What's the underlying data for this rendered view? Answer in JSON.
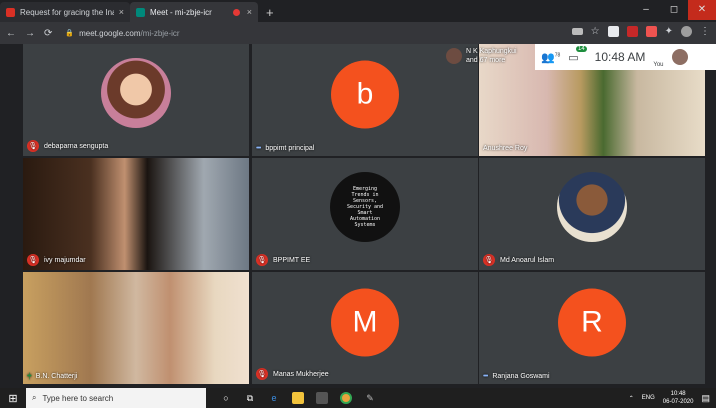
{
  "browser": {
    "tabs": [
      {
        "title": "Request for gracing the Inaugur",
        "close": "×",
        "favicon_color": "#d93025"
      },
      {
        "title": "Meet - mi-zbje-icr",
        "close": "×",
        "favicon_color": "#00897b"
      }
    ],
    "new_tab": "+",
    "window_controls": [
      "–",
      "◻",
      "✕"
    ],
    "url_host": "meet.google.com",
    "url_path": "/mi-zbje-icr"
  },
  "meet": {
    "owner_name": "N K Kaphungkui",
    "participant_more": "and 67 more",
    "people_count": "78",
    "chat_badge": "14",
    "time": "10:48 AM",
    "you_label": "You",
    "tiles": [
      {
        "name": "debaparna sengupta",
        "muted": true,
        "kind": "photo"
      },
      {
        "name": "bppimt principal",
        "muted": false,
        "kind": "letter",
        "letter": "b",
        "color": "#f4511e"
      },
      {
        "name": "Anushree Roy",
        "muted": false,
        "kind": "video"
      },
      {
        "name": "ivy majumdar",
        "muted": true,
        "kind": "video"
      },
      {
        "name": "BPPIMT EE",
        "muted": true,
        "kind": "poster",
        "poster_lines": [
          "Emerging",
          "Trends in",
          "Sensors,",
          "Security and",
          "Smart",
          "Automation",
          "Systems"
        ]
      },
      {
        "name": "Md Anoarul Islam",
        "muted": true,
        "kind": "photo"
      },
      {
        "name": "B.N. Chatterji",
        "muted": false,
        "kind": "video"
      },
      {
        "name": "Manas Mukherjee",
        "muted": true,
        "kind": "letter",
        "letter": "M",
        "color": "#f4511e"
      },
      {
        "name": "Ranjana Goswami",
        "muted": false,
        "kind": "letter",
        "letter": "R",
        "color": "#f4511e"
      }
    ]
  },
  "taskbar": {
    "search_placeholder": "Type here to search",
    "lang": "ENG",
    "clock_time": "10:48",
    "clock_date": "06-07-2020"
  }
}
